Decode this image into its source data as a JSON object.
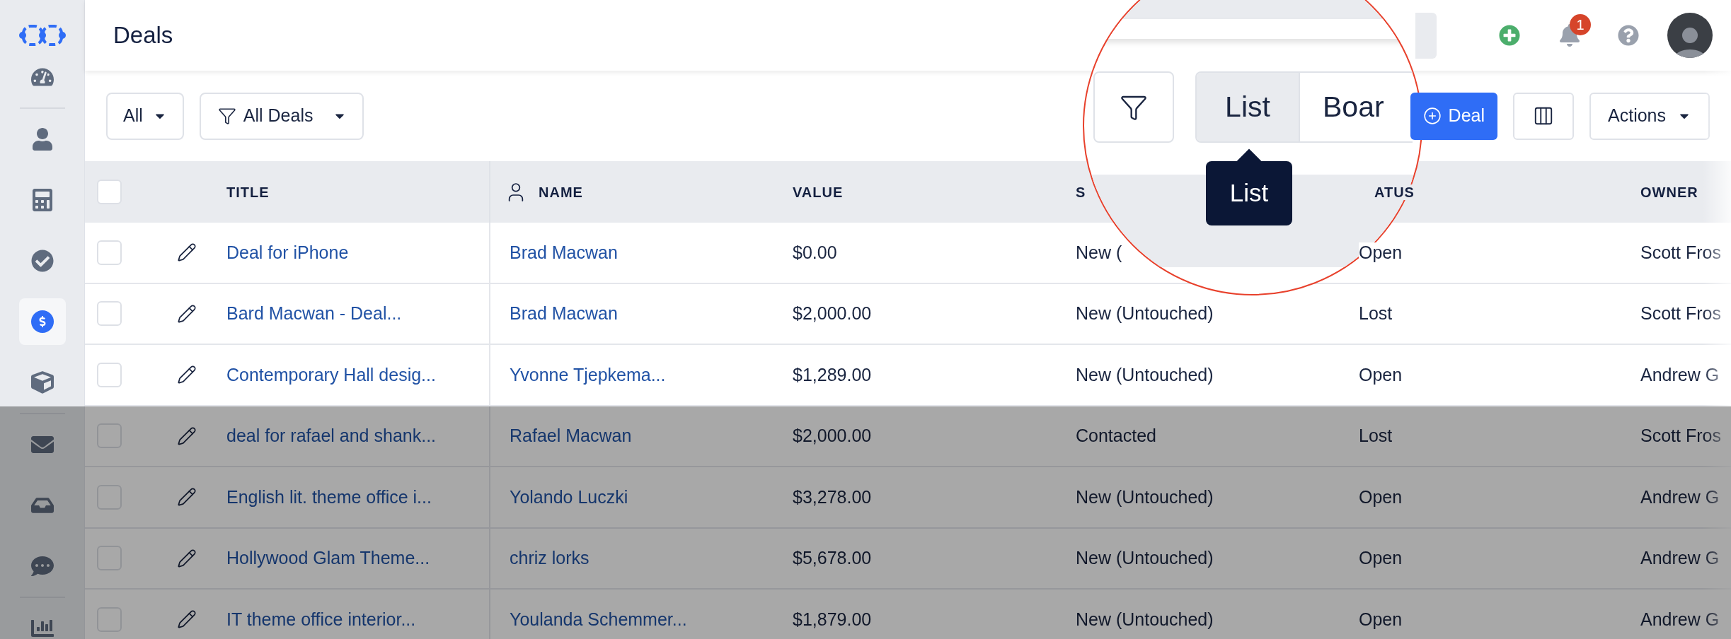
{
  "sidebar": {
    "items": [
      {
        "selected": false
      },
      {
        "selected": false
      },
      {
        "selected": false
      },
      {
        "selected": false
      },
      {
        "selected": true
      },
      {
        "selected": false
      },
      {
        "selected": false
      },
      {
        "selected": false
      },
      {
        "selected": false
      },
      {
        "selected": false
      }
    ]
  },
  "header": {
    "title": "Deals",
    "notification_count": "1"
  },
  "toolbar": {
    "scope": "All",
    "view": "All Deals",
    "new_button": "Deal",
    "actions": "Actions"
  },
  "magnifier": {
    "view_toggle": [
      {
        "label": "List",
        "selected": true
      },
      {
        "label": "Boar",
        "selected": false
      }
    ],
    "tooltip": "List"
  },
  "table": {
    "select_all": {
      "checked": false
    },
    "columns": [
      "TITLE",
      "NAME",
      "VALUE",
      "S",
      "ATUS",
      "OWNER"
    ],
    "rows": [
      {
        "checked": false,
        "title": "Deal for iPhone",
        "name": "Brad Macwan",
        "value": "$0.00",
        "stage": "New (",
        "status": "Open",
        "owner": "Scott Fros"
      },
      {
        "checked": false,
        "title": "Bard Macwan - Deal...",
        "name": "Brad Macwan",
        "value": "$2,000.00",
        "stage": "New (Untouched)",
        "status": "Lost",
        "owner": "Scott Fros"
      },
      {
        "checked": false,
        "title": "Contemporary Hall desig...",
        "name": "Yvonne Tjepkema...",
        "value": "$1,289.00",
        "stage": "New (Untouched)",
        "status": "Open",
        "owner": "Andrew G"
      },
      {
        "checked": false,
        "title": "deal for rafael and shank...",
        "name": "Rafael Macwan",
        "value": "$2,000.00",
        "stage": "Contacted",
        "status": "Lost",
        "owner": "Scott Fros"
      },
      {
        "checked": false,
        "title": "English lit. theme office i...",
        "name": "Yolando Luczki",
        "value": "$3,278.00",
        "stage": "New (Untouched)",
        "status": "Open",
        "owner": "Andrew G"
      },
      {
        "checked": false,
        "title": "Hollywood Glam Theme...",
        "name": "chriz lorks",
        "value": "$5,678.00",
        "stage": "New (Untouched)",
        "status": "Open",
        "owner": "Andrew G"
      },
      {
        "checked": false,
        "title": "IT theme office interior...",
        "name": "Youlanda Schemmer...",
        "value": "$1,879.00",
        "stage": "New (Untouched)",
        "status": "Open",
        "owner": "Andrew G"
      }
    ]
  }
}
